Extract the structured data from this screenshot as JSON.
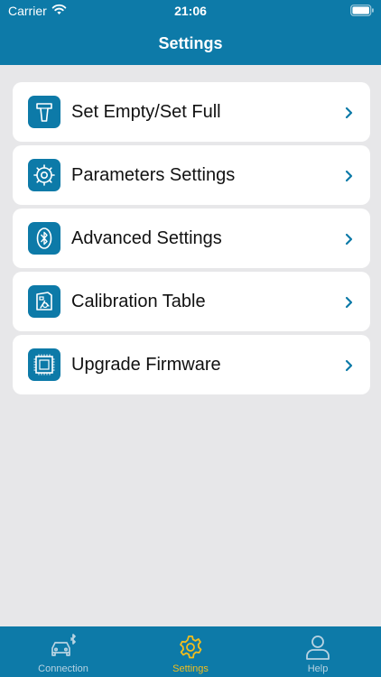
{
  "status_bar": {
    "carrier": "Carrier",
    "time": "21:06"
  },
  "header": {
    "title": "Settings"
  },
  "menu": {
    "items": [
      {
        "label": "Set Empty/Set Full",
        "icon": "sensor-probe-icon"
      },
      {
        "label": "Parameters Settings",
        "icon": "gear-icon"
      },
      {
        "label": "Advanced Settings",
        "icon": "bluetooth-icon"
      },
      {
        "label": "Calibration Table",
        "icon": "fuel-gauge-icon"
      },
      {
        "label": "Upgrade Firmware",
        "icon": "chip-icon"
      }
    ]
  },
  "tabbar": {
    "tabs": [
      {
        "label": "Connection",
        "icon": "car-bluetooth-icon",
        "active": false
      },
      {
        "label": "Settings",
        "icon": "gear-icon",
        "active": true
      },
      {
        "label": "Help",
        "icon": "person-icon",
        "active": false
      }
    ]
  },
  "colors": {
    "brand": "#0d7aa8",
    "active_tab": "#f4be1b",
    "background": "#e7e7e9"
  }
}
